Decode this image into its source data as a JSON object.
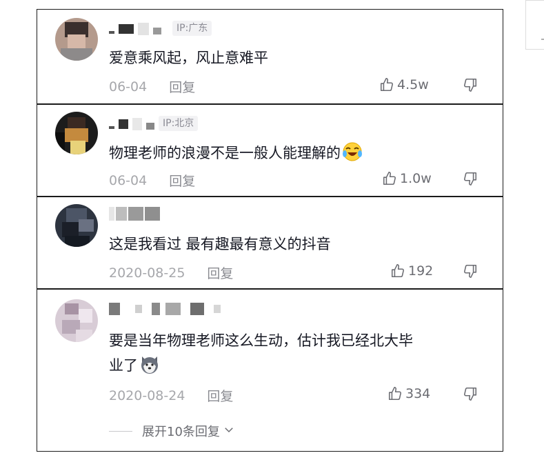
{
  "comments": [
    {
      "ip": "IP:广东",
      "text": "爱意乘风起，风止意难平",
      "date": "06-04",
      "reply": "回复",
      "likes": "4.5w"
    },
    {
      "ip": "IP:北京",
      "text": "物理老师的浪漫不是一般人能理解的",
      "date": "06-04",
      "reply": "回复",
      "likes": "1.0w"
    },
    {
      "text": "这是我看过 最有趣最有意义的抖音",
      "date": "2020-08-25",
      "reply": "回复",
      "likes": "192"
    },
    {
      "text_line1": "要是当年物理老师这么生动，估计我已经北大毕",
      "text_line2": "业了",
      "date": "2020-08-24",
      "reply": "回复",
      "likes": "334",
      "expand": "展开10条回复"
    }
  ],
  "icons": {
    "like": "thumbs-up-icon",
    "dislike": "thumbs-down-icon",
    "expand": "chevron-down-icon",
    "emoji1": "laughing-crying-emoji",
    "emoji2": "husky-dog-emoji"
  },
  "colors": {
    "text": "#161823",
    "meta": "#a6a7ab",
    "badge_bg": "#f2f2f4"
  }
}
